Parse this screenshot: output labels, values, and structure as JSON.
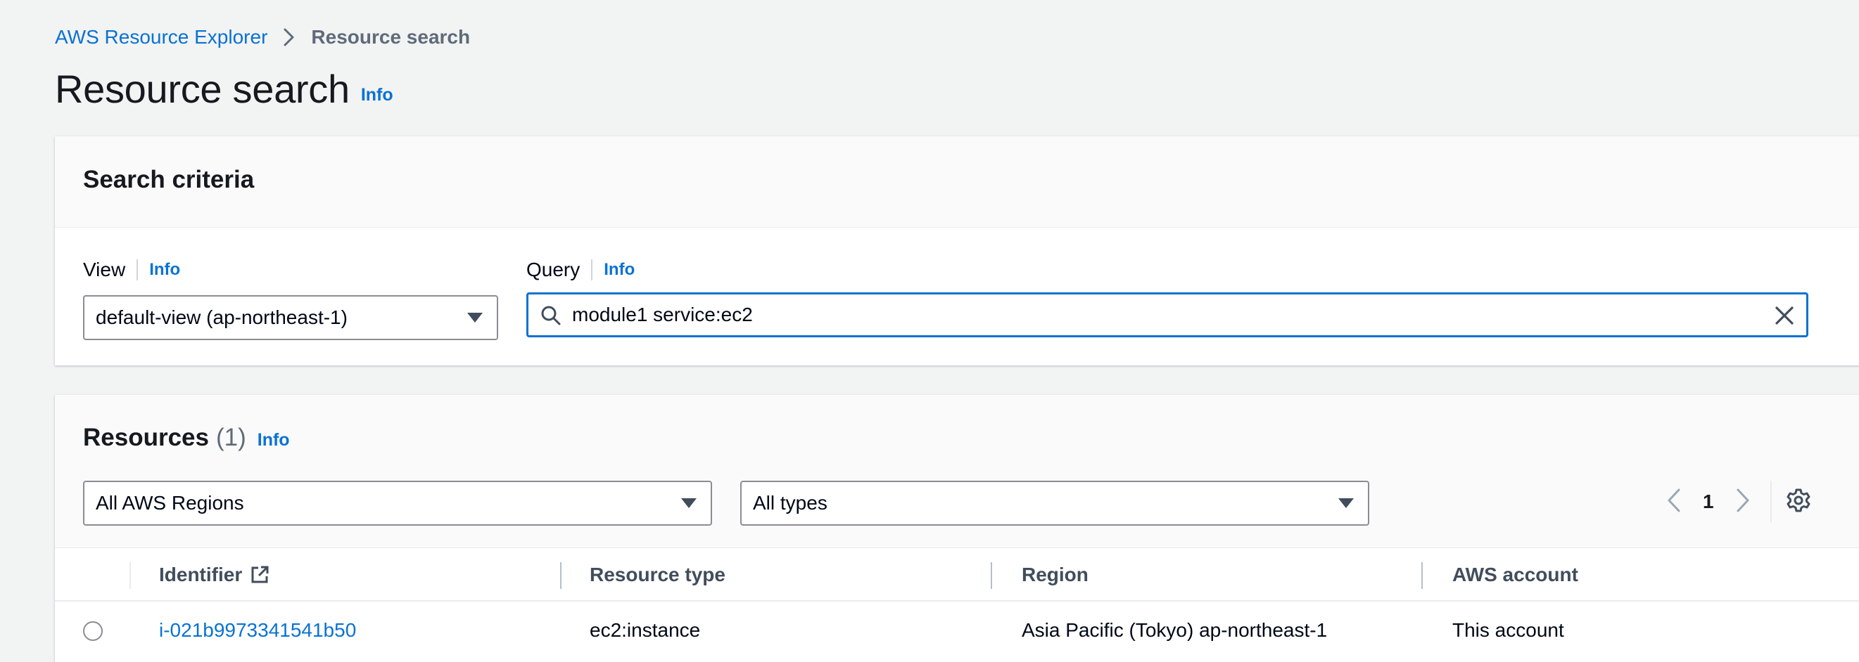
{
  "breadcrumb": {
    "parent": "AWS Resource Explorer",
    "current": "Resource search"
  },
  "header": {
    "title": "Resource search",
    "info": "Info"
  },
  "search_criteria": {
    "title": "Search criteria",
    "view": {
      "label": "View",
      "info": "Info",
      "selected": "default-view (ap-northeast-1)"
    },
    "query": {
      "label": "Query",
      "info": "Info",
      "value": "module1 service:ec2"
    }
  },
  "resources": {
    "title": "Resources",
    "count": "(1)",
    "info": "Info",
    "region_filter": "All AWS Regions",
    "type_filter": "All types",
    "page": "1",
    "columns": {
      "identifier": "Identifier",
      "resource_type": "Resource type",
      "region": "Region",
      "account": "AWS account"
    },
    "rows": [
      {
        "identifier": "i-021b9973341541b50",
        "resource_type": "ec2:instance",
        "region": "Asia Pacific (Tokyo) ap-northeast-1",
        "account": "This account"
      }
    ]
  },
  "colors": {
    "link": "#0972d3",
    "text": "#16191f",
    "secondary": "#5f6b7a",
    "background": "#f2f3f3"
  }
}
